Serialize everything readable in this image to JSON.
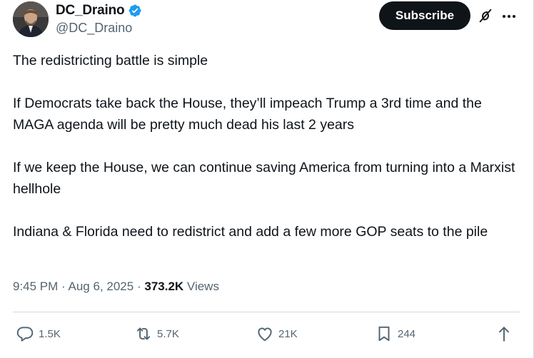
{
  "author": {
    "display_name": "DC_Draino",
    "handle": "@DC_Draino",
    "verified": true,
    "verified_color": "#1d9bf0"
  },
  "header": {
    "subscribe_label": "Subscribe",
    "icons": [
      "grok-icon",
      "more-icon"
    ]
  },
  "tweet": {
    "paragraphs": [
      "The redistricting battle is simple",
      "If Democrats take back the House, they’ll impeach Trump a 3rd time and the MAGA agenda will be pretty much dead his last 2 years",
      "If we keep the House, we can continue saving America from turning into a Marxist hellhole",
      "Indiana & Florida need to redistrict and add a few more GOP seats to the pile"
    ]
  },
  "meta": {
    "time": "9:45 PM",
    "separator": "·",
    "date": "Aug 6, 2025",
    "views_count": "373.2K",
    "views_label": "Views"
  },
  "actions": {
    "replies": "1.5K",
    "reposts": "5.7K",
    "likes": "21K",
    "bookmarks": "244"
  }
}
